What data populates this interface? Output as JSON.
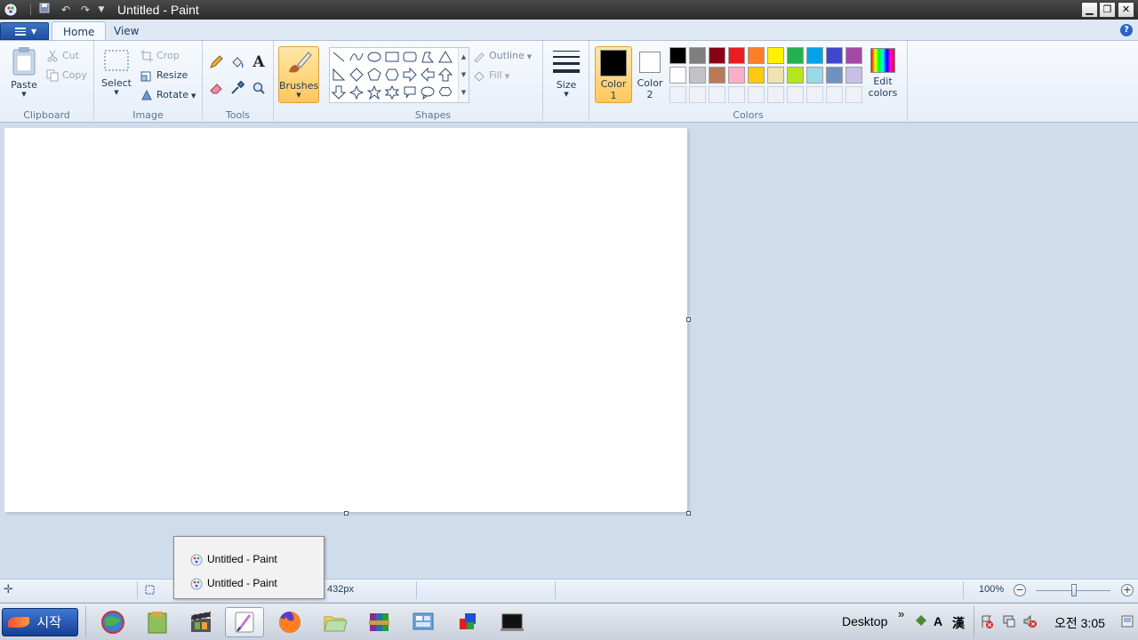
{
  "window": {
    "title": "Untitled - Paint",
    "min_glyph": "▁",
    "restore_glyph": "❐",
    "close_glyph": "✕"
  },
  "tabs": [
    {
      "label": "Home",
      "active": true
    },
    {
      "label": "View",
      "active": false
    }
  ],
  "ribbon": {
    "clipboard": {
      "group_label": "Clipboard",
      "paste": "Paste",
      "cut": "Cut",
      "copy": "Copy"
    },
    "image": {
      "group_label": "Image",
      "select": "Select",
      "crop": "Crop",
      "resize": "Resize",
      "rotate": "Rotate"
    },
    "tools": {
      "group_label": "Tools",
      "text_glyph": "A"
    },
    "brushes": {
      "label": "Brushes"
    },
    "shapes": {
      "group_label": "Shapes",
      "outline": "Outline",
      "fill": "Fill"
    },
    "size": {
      "label": "Size"
    },
    "colors": {
      "group_label": "Colors",
      "color1_line1": "Color",
      "color1_line2": "1",
      "color2_line1": "Color",
      "color2_line2": "2",
      "edit_line1": "Edit",
      "edit_line2": "colors",
      "color1_value": "#000000",
      "color2_value": "#ffffff",
      "palette_row1": [
        "#000000",
        "#7f7f7f",
        "#880015",
        "#ed1c24",
        "#ff7f27",
        "#fff200",
        "#22b14c",
        "#00a2e8",
        "#3f48cc",
        "#a349a4"
      ],
      "palette_row2": [
        "#ffffff",
        "#c3c3c3",
        "#b97a57",
        "#ffaec9",
        "#ffc90e",
        "#efe4b0",
        "#b5e61d",
        "#99d9ea",
        "#7092be",
        "#c8bfe7"
      ]
    }
  },
  "statusbar": {
    "size_text": "432px",
    "zoom": "100%"
  },
  "popup": {
    "items": [
      "Untitled - Paint",
      "Untitled - Paint"
    ]
  },
  "taskbar": {
    "start_label": "시작",
    "desktop_label": "Desktop",
    "chevron": "»",
    "ime_a": "A",
    "ime_han": "漢",
    "clock": "오전 3:05"
  }
}
